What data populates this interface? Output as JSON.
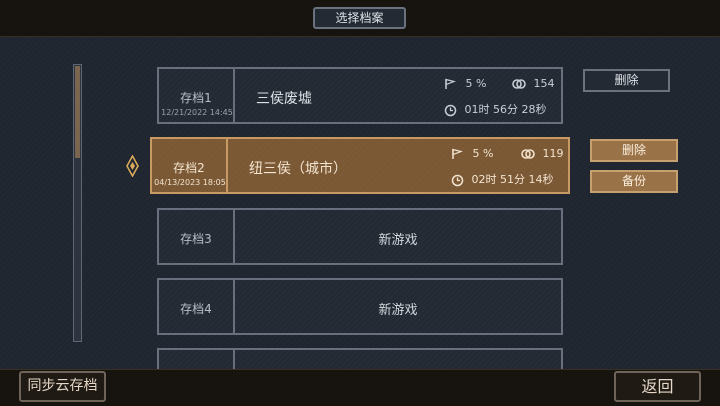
{
  "header": {
    "title": "选择档案"
  },
  "slots": [
    {
      "label": "存档1",
      "date": "12/21/2022 14:45",
      "name": "三侯废墟",
      "progress": "5 %",
      "coins": "154",
      "playtime": "01时 56分 28秒",
      "action1": "删除"
    },
    {
      "label": "存档2",
      "date": "04/13/2023 18:05",
      "name": "纽三侯（城市）",
      "progress": "5 %",
      "coins": "119",
      "playtime": "02时 51分 14秒",
      "action1": "删除",
      "action2": "备份"
    },
    {
      "label": "存档3",
      "new_game": "新游戏"
    },
    {
      "label": "存档4",
      "new_game": "新游戏"
    }
  ],
  "footer": {
    "sync_label": "同步云存档",
    "back_label": "返回"
  },
  "colors": {
    "selected_bg": "#7d5a36",
    "selected_border": "#c89a63",
    "panel_bg": "#232a34",
    "panel_border": "#67707c"
  },
  "icons": {
    "progress": "flag-icon",
    "coins": "coins-icon",
    "time": "clock-icon",
    "selection": "diamond-marker-icon"
  }
}
